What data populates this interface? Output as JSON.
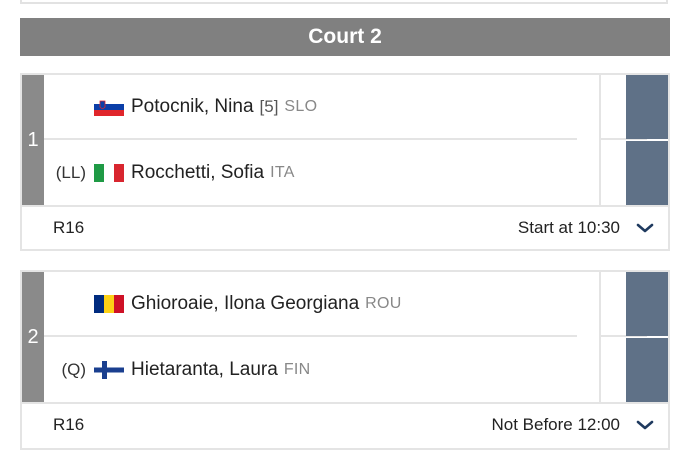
{
  "court": {
    "title": "Court 2"
  },
  "matches": [
    {
      "order": "1",
      "players": [
        {
          "entry": "",
          "name": "Potocnik, Nina",
          "seed": "[5]",
          "country": "SLO",
          "flag": "slovenia-flag"
        },
        {
          "entry": "(LL)",
          "name": "Rocchetti, Sofia",
          "seed": "",
          "country": "ITA",
          "flag": "italy-flag"
        }
      ],
      "round": "R16",
      "time": "Start at 10:30"
    },
    {
      "order": "2",
      "players": [
        {
          "entry": "",
          "name": "Ghioroaie, Ilona Georgiana",
          "seed": "",
          "country": "ROU",
          "flag": "romania-flag"
        },
        {
          "entry": "(Q)",
          "name": "Hietaranta, Laura",
          "seed": "",
          "country": "FIN",
          "flag": "finland-flag"
        }
      ],
      "round": "R16",
      "time": "Not Before 12:00"
    }
  ],
  "colors": {
    "header_bg": "#808080",
    "order_bg": "#8a8a8a",
    "status_bg": "#5f7187",
    "chevron": "#1f3a5f"
  }
}
